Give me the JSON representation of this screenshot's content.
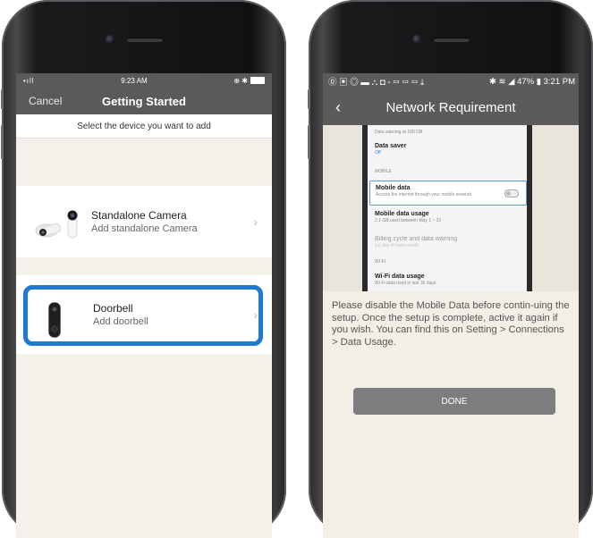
{
  "left_phone": {
    "status_bar": {
      "signal": "•ıll",
      "time": "9:23 AM",
      "right": "⊕ ✱"
    },
    "nav": {
      "cancel": "Cancel",
      "title": "Getting Started"
    },
    "subheader": "Select the device you want to add",
    "devices": [
      {
        "name": "Standalone Camera",
        "subtitle": "Add standalone Camera",
        "icon": "camera-icon"
      },
      {
        "name": "Doorbell",
        "subtitle": "Add doorbell",
        "icon": "doorbell-icon"
      }
    ],
    "highlight_color": "#1f78d1"
  },
  "right_phone": {
    "status_bar": {
      "left": "⓪ ▣ ◎ ▬ ⛬ ◘ ◦ ▭ ▭ ▭ ⤓",
      "right": "✱ ≋ ◢ 47% ▮ 3:21 PM"
    },
    "nav": {
      "title": "Network Requirement"
    },
    "settings_screenshot": {
      "data_warning": "Data warning at 100 GB",
      "data_saver": "Data saver",
      "data_saver_state": "Off",
      "mobile_section": "MOBILE",
      "mobile_data": "Mobile data",
      "mobile_data_sub": "Access the internet through your mobile network.",
      "mobile_usage": "Mobile data usage",
      "mobile_usage_sub": "2.1 GB used between May 1 ~ 31",
      "billing": "Billing cycle and data warning",
      "billing_sub": "1st day of each month",
      "wifi_section": "WI-FI",
      "wifi_usage": "Wi-Fi data usage",
      "wifi_usage_sub": "Wi-Fi data used in last 30 days"
    },
    "instructions": "Please disable the Mobile Data before contin-uing the setup. Once the setup is complete, active it again if you wish. You can find this on Setting > Connections > Data Usage.",
    "done_button": "DONE"
  }
}
